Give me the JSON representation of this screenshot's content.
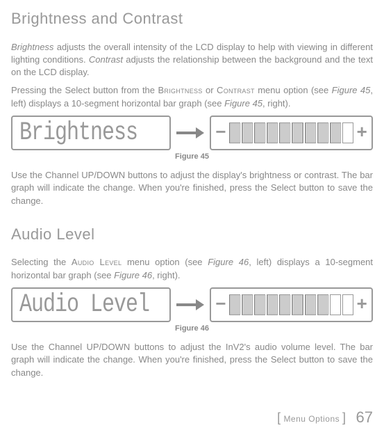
{
  "section1": {
    "heading": "Brightness and Contrast",
    "p1_a": "Brightness",
    "p1_b": " adjusts the overall intensity of the LCD display to help with viewing in different lighting conditions. ",
    "p1_c": "Contrast",
    "p1_d": " adjusts the relationship between the background and the text on the LCD display.",
    "p2_a": "Pressing the Select button from the ",
    "p2_b": "Brightness",
    "p2_c": " or ",
    "p2_d": "Contrast",
    "p2_e": " menu option (see ",
    "p2_f": "Figure 45",
    "p2_g": ", left) displays a 10-segment horizontal bar graph (see ",
    "p2_h": "Figure 45",
    "p2_i": ", right).",
    "lcd_text": "Brightness",
    "fig_caption": "Figure 45",
    "p3": "Use the Channel UP/DOWN buttons to adjust the display's brightness or contrast. The bar graph will indicate the change. When you're finished, press the Select button to save the change."
  },
  "section2": {
    "heading": "Audio Level",
    "p1_a": "Selecting the ",
    "p1_b": "Audio Level",
    "p1_c": " menu option (see ",
    "p1_d": "Figure 46",
    "p1_e": ", left) displays a 10-segment horizontal bar graph (see ",
    "p1_f": "Figure 46",
    "p1_g": ", right).",
    "lcd_text": "Audio Level",
    "fig_caption": "Figure 46",
    "p2": "Use the Channel UP/DOWN buttons to adjust the InV2's audio volume level. The bar graph will indicate the change. When you're finished, press the Select button to save the change."
  },
  "footer": {
    "section_label": "Menu Options",
    "page_number": "67"
  },
  "bargraph": {
    "minus": "−",
    "plus": "+",
    "fill1": [
      true,
      true,
      true,
      true,
      true,
      true,
      true,
      true,
      true,
      false
    ],
    "fill2": [
      true,
      true,
      true,
      true,
      true,
      true,
      true,
      true,
      false,
      false
    ]
  }
}
